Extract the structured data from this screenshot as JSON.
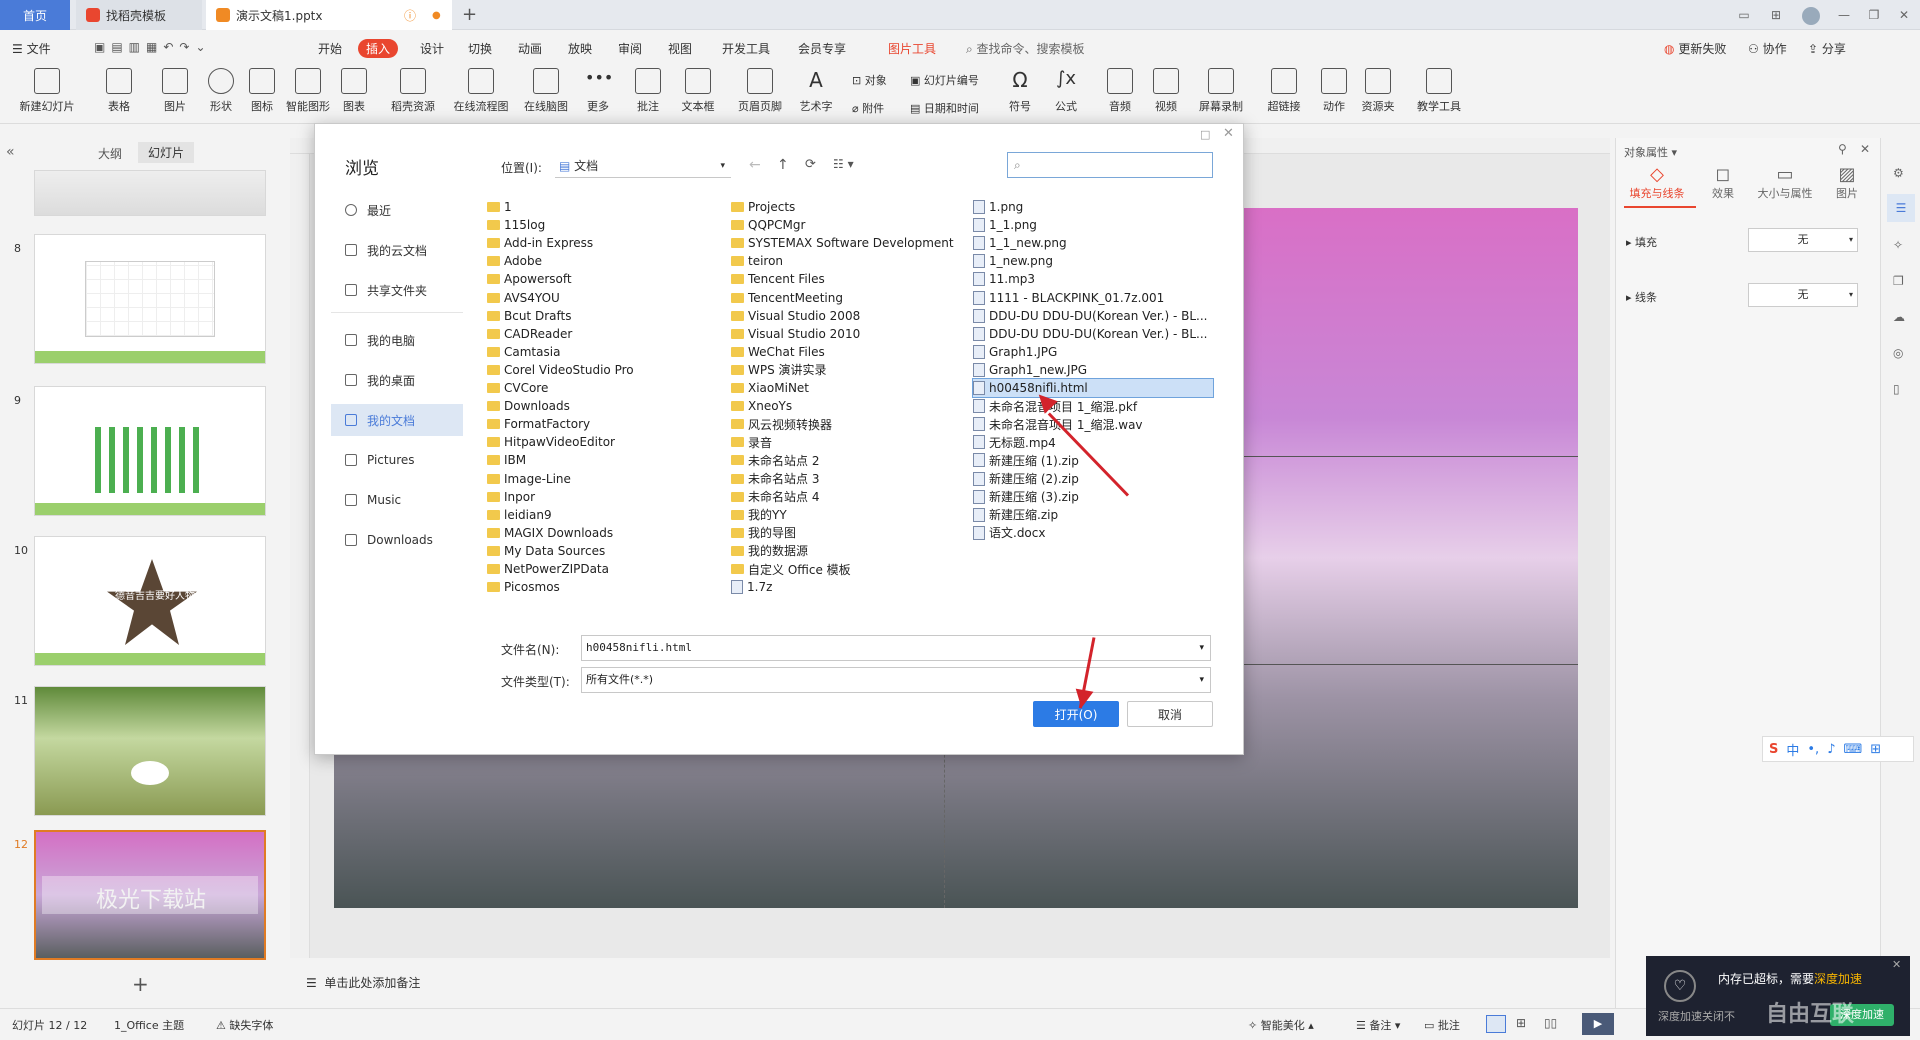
{
  "titlebar": {
    "tabs": [
      {
        "label": "首页"
      },
      {
        "label": "找稻壳模板"
      },
      {
        "label": "演示文稿1.pptx"
      }
    ],
    "add_tab": "+"
  },
  "menubar": {
    "items": [
      "文件",
      "开始",
      "插入",
      "设计",
      "切换",
      "动画",
      "放映",
      "审阅",
      "视图",
      "开发工具",
      "会员专享",
      "图片工具"
    ],
    "search": "查找命令、搜索模板",
    "right": [
      "更新失败",
      "协作",
      "分享"
    ]
  },
  "ribbon": {
    "items": [
      "新建幻灯片",
      "表格",
      "图片",
      "形状",
      "图标",
      "智能图形",
      "图表",
      "稻壳资源",
      "在线流程图",
      "在线脑图",
      "更多",
      "批注",
      "文本框",
      "页眉页脚",
      "艺术字",
      "符号",
      "公式",
      "音频",
      "视频",
      "屏幕录制",
      "超链接",
      "动作",
      "资源夹",
      "教学工具"
    ],
    "small": [
      "对象",
      "幻灯片编号",
      "附件",
      "日期和时间"
    ]
  },
  "leftpanel": {
    "tabs": [
      "大纲",
      "幻灯片"
    ],
    "slide_numbers": [
      "8",
      "9",
      "10",
      "11",
      "12"
    ],
    "slide10_text": "德音吉吉要好人物",
    "slide12_text": "极光下载站",
    "add": "+"
  },
  "dialog": {
    "title": "浏览",
    "location_label": "位置(I):",
    "location_value": "文档",
    "nav": [
      "最近",
      "我的云文档",
      "共享文件夹",
      "我的电脑",
      "我的桌面",
      "我的文档",
      "Pictures",
      "Music",
      "Downloads"
    ],
    "col1": [
      "1",
      "115log",
      "Add-in Express",
      "Adobe",
      "Apowersoft",
      "AVS4YOU",
      "Bcut Drafts",
      "CADReader",
      "Camtasia",
      "Corel VideoStudio Pro",
      "CVCore",
      "Downloads",
      "FormatFactory",
      "HitpawVideoEditor",
      "IBM",
      "Image-Line",
      "Inpor",
      "leidian9",
      "MAGIX Downloads",
      "My Data Sources",
      "NetPowerZIPData",
      "Picosmos"
    ],
    "col2": [
      "Projects",
      "QQPCMgr",
      "SYSTEMAX Software Development",
      "teiron",
      "Tencent Files",
      "TencentMeeting",
      "Visual Studio 2008",
      "Visual Studio 2010",
      "WeChat Files",
      "WPS 演讲实录",
      "XiaoMiNet",
      "XneoYs",
      "风云视频转换器",
      "录音",
      "未命名站点 2",
      "未命名站点 3",
      "未命名站点 4",
      "我的YY",
      "我的导图",
      "我的数据源",
      "自定义 Office 模板",
      "1.7z"
    ],
    "col3": [
      "1.png",
      "1_1.png",
      "1_1_new.png",
      "1_new.png",
      "11.mp3",
      "1111 - BLACKPINK_01.7z.001",
      "DDU-DU DDU-DU(Korean Ver.) - BL...",
      "DDU-DU DDU-DU(Korean Ver.) - BL...",
      "Graph1.JPG",
      "Graph1_new.JPG",
      "h00458nifli.html",
      "未命名混音项目 1_缩混.pkf",
      "未命名混音项目 1_缩混.wav",
      "无标题.mp4",
      "新建压缩 (1).zip",
      "新建压缩 (2).zip",
      "新建压缩 (3).zip",
      "新建压缩.zip",
      "语文.docx"
    ],
    "filename_label": "文件名(N):",
    "filename_value": "h00458nifli.html",
    "filetype_label": "文件类型(T):",
    "filetype_value": "所有文件(*.*)",
    "open_button": "打开(O)",
    "cancel_button": "取消"
  },
  "rightpanel": {
    "title": "对象属性",
    "tabs": [
      "填充与线条",
      "效果",
      "大小与属性",
      "图片"
    ],
    "fill_label": "填充",
    "fill_value": "无",
    "line_label": "线条",
    "line_value": "无"
  },
  "ime": {
    "items": [
      "中",
      "•,"
    ]
  },
  "notes": "单击此处添加备注",
  "statusbar": {
    "slide_info": "幻灯片 12 / 12",
    "theme": "1_Office 主题",
    "missing_font": "缺失字体",
    "beautify": "智能美化",
    "notes_btn": "备注",
    "comment_btn": "批注"
  },
  "popup": {
    "text1": "内存已超标，需要",
    "text2": "深度加速",
    "text3": "深度加速关闭不",
    "button": "深度加速"
  },
  "watermark": "自由互联",
  "colors": {
    "accent": "#4a7bd8",
    "red": "#e9462f",
    "arrow": "#d3232b",
    "primary_btn": "#2c7be5"
  }
}
